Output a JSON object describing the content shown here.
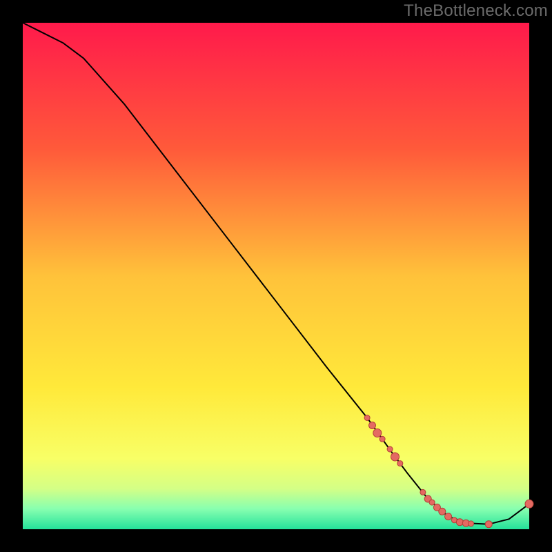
{
  "watermark": {
    "text": "TheBottleneck.com"
  },
  "colors": {
    "page_bg": "#000000",
    "curve": "#000000",
    "dot_fill": "#e46a62",
    "dot_stroke": "#b43f37",
    "gradient_stops": [
      {
        "pct": 0,
        "color": "#ff1a4b"
      },
      {
        "pct": 25,
        "color": "#ff5a3a"
      },
      {
        "pct": 50,
        "color": "#ffc23a"
      },
      {
        "pct": 72,
        "color": "#ffe93a"
      },
      {
        "pct": 86,
        "color": "#f8ff66"
      },
      {
        "pct": 92,
        "color": "#d4ff86"
      },
      {
        "pct": 96,
        "color": "#87ffb0"
      },
      {
        "pct": 100,
        "color": "#24e29a"
      }
    ]
  },
  "chart_data": {
    "type": "line",
    "title": "",
    "xlabel": "",
    "ylabel": "",
    "xlim": [
      0,
      100
    ],
    "ylim": [
      0,
      100
    ],
    "grid": false,
    "legend": false,
    "series": [
      {
        "name": "curve",
        "x": [
          0,
          4,
          8,
          12,
          20,
          30,
          40,
          50,
          60,
          68,
          73,
          76,
          80,
          84,
          88,
          92,
          96,
          100
        ],
        "y": [
          100,
          98,
          96,
          93,
          84,
          71,
          58,
          45,
          32,
          22,
          15,
          11,
          6,
          2.5,
          1.2,
          1.0,
          2.0,
          5
        ]
      }
    ],
    "scatter": [
      {
        "name": "dots",
        "points": [
          {
            "x": 68.0,
            "y": 22.0,
            "r": 4
          },
          {
            "x": 69.0,
            "y": 20.5,
            "r": 5
          },
          {
            "x": 70.0,
            "y": 19.0,
            "r": 6
          },
          {
            "x": 71.0,
            "y": 17.8,
            "r": 4
          },
          {
            "x": 72.5,
            "y": 15.8,
            "r": 4
          },
          {
            "x": 73.5,
            "y": 14.3,
            "r": 6
          },
          {
            "x": 74.5,
            "y": 13.0,
            "r": 4
          },
          {
            "x": 79.0,
            "y": 7.3,
            "r": 4
          },
          {
            "x": 80.0,
            "y": 6.0,
            "r": 5
          },
          {
            "x": 80.8,
            "y": 5.3,
            "r": 4
          },
          {
            "x": 81.8,
            "y": 4.3,
            "r": 5
          },
          {
            "x": 82.8,
            "y": 3.5,
            "r": 5
          },
          {
            "x": 84.0,
            "y": 2.5,
            "r": 5
          },
          {
            "x": 85.2,
            "y": 1.8,
            "r": 4
          },
          {
            "x": 86.3,
            "y": 1.4,
            "r": 5
          },
          {
            "x": 87.5,
            "y": 1.2,
            "r": 5
          },
          {
            "x": 88.5,
            "y": 1.1,
            "r": 4
          },
          {
            "x": 92.0,
            "y": 1.0,
            "r": 5
          },
          {
            "x": 100.0,
            "y": 5.0,
            "r": 6
          }
        ]
      }
    ]
  }
}
